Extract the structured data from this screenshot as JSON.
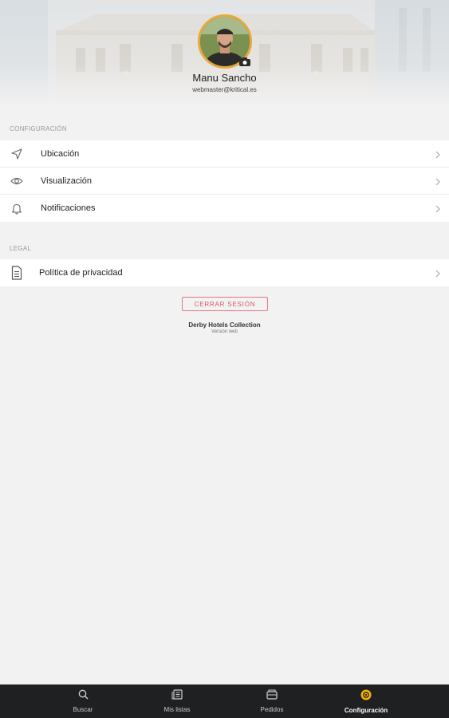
{
  "profile": {
    "name": "Manu Sancho",
    "email": "webmaster@kritical.es"
  },
  "sections": {
    "config_label": "CONFIGURACIÓN",
    "legal_label": "LEGAL"
  },
  "config_items": [
    {
      "label": "Ubicación",
      "icon": "navigation-arrow-icon"
    },
    {
      "label": "Visualización",
      "icon": "eye-icon"
    },
    {
      "label": "Notificaciones",
      "icon": "bell-icon"
    }
  ],
  "legal_items": [
    {
      "label": "Política de privacidad",
      "icon": "document-icon"
    }
  ],
  "logout_label": "CERRAR SESIÓN",
  "footer": {
    "org": "Derby Hotels Collection",
    "version": "Versión web"
  },
  "tabs": [
    {
      "label": "Buscar",
      "icon": "search-icon",
      "active": false
    },
    {
      "label": "Mis listas",
      "icon": "list-icon",
      "active": false
    },
    {
      "label": "Pedidos",
      "icon": "orders-icon",
      "active": false
    },
    {
      "label": "Configuración",
      "icon": "settings-gear-icon",
      "active": true
    }
  ],
  "colors": {
    "accent": "#f5b301",
    "logout": "#e05561",
    "tabbar": "#1e2022",
    "background": "#f2f2f2"
  }
}
